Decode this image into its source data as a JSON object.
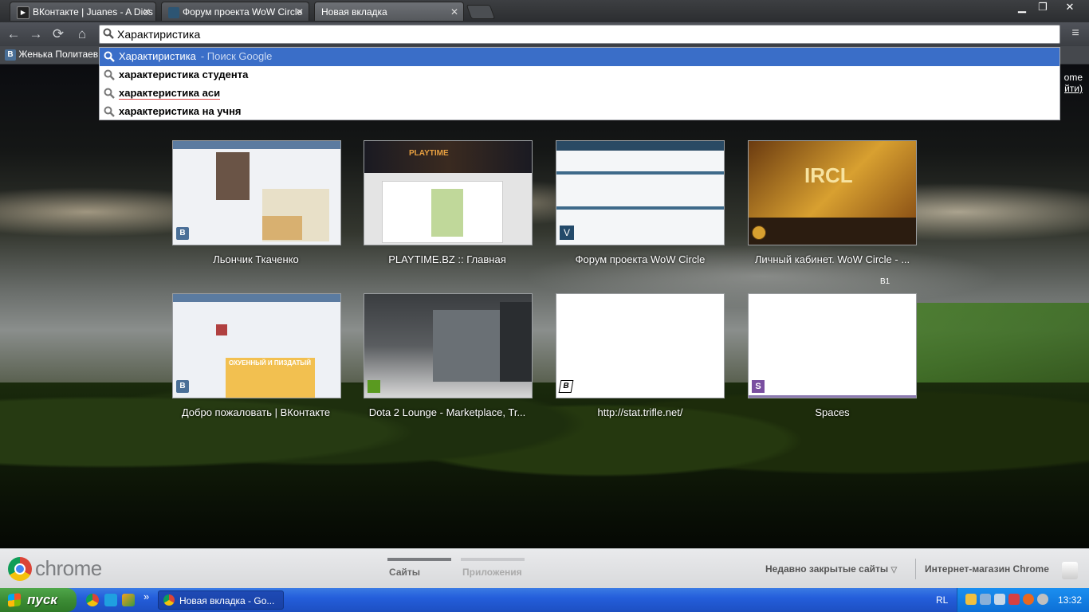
{
  "tabs": [
    {
      "label": "ВКонтакте | Juanes - A Dios",
      "close": "✕"
    },
    {
      "label": "Форум проекта WoW Circle",
      "close": "✕"
    },
    {
      "label": "Новая вкладка",
      "close": "✕"
    }
  ],
  "window_controls": {
    "minimize": "▁",
    "maximize": "❐",
    "close": "✕"
  },
  "nav": {
    "back": "←",
    "forward": "→",
    "reload": "⟳",
    "home": "⌂",
    "menu": "≡"
  },
  "omnibox": {
    "value": "Характиристика"
  },
  "bookmarks": [
    {
      "icon": "В",
      "label": "Женька Политаев"
    }
  ],
  "suggestions": [
    {
      "text": "Характиристика",
      "hint": "- Поиск Google"
    },
    {
      "text": "характеристика студента"
    },
    {
      "text": "характеристика аси"
    },
    {
      "text": "характеристика на учня"
    }
  ],
  "signin": {
    "line1": "ome",
    "line2": "йти)"
  },
  "most_visited": [
    {
      "title": "Льончик Ткаченко",
      "icon": "В"
    },
    {
      "title": "PLAYTIME.BZ :: Главная",
      "icon": ""
    },
    {
      "title": "Форум проекта WoW Circle",
      "icon": ""
    },
    {
      "title": "Личный кабинет. WoW Circle - ...",
      "icon": ""
    },
    {
      "title": "Добро пожаловать | ВКонтакте",
      "icon": "В"
    },
    {
      "title": "Dota 2 Lounge - Marketplace, Tr...",
      "icon": ""
    },
    {
      "title": "http://stat.trifle.net/",
      "icon": "В"
    },
    {
      "title": "Spaces",
      "icon": "S"
    }
  ],
  "thumb_texts": {
    "playtime_logo": "PLAYTIME",
    "circle_logo": "IRCL",
    "vk_banner": "ОХУЕННЫЙ И ПИЗДАТЫЙ",
    "overlay": "В1"
  },
  "footer": {
    "brand": "chrome",
    "tab_sites": "Сайты",
    "tab_apps": "Приложения",
    "recently_closed": "Недавно закрытые сайты",
    "recently_closed_arrow": "▽",
    "webstore": "Интернет-магазин Chrome"
  },
  "taskbar": {
    "start": "пуск",
    "quicklaunch_more": "»",
    "task": "Новая вкладка - Go...",
    "lang": "RL",
    "clock": "13:32"
  },
  "colors": {
    "suggest_selected": "#3a6ec8",
    "taskbar": "#245edb",
    "start": "#3c8c35"
  }
}
